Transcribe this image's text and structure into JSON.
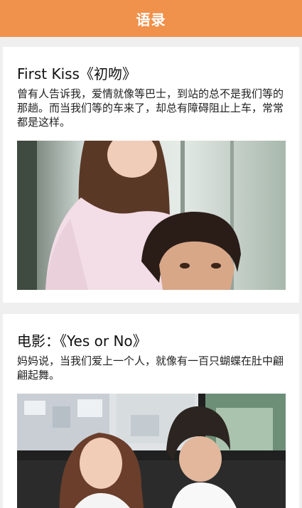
{
  "header": {
    "title": "语录"
  },
  "posts": [
    {
      "title": "First Kiss《初吻》",
      "text": "曾有人告诉我，爱情就像等巴士，到站的总不是我们等的那趟。而当我们等的车来了，却总有障碍阻止上车，常常都是这样。",
      "image": "couple-photo"
    },
    {
      "title": "电影：《Yes or No》",
      "text": "妈妈说，当我们爱上一个人，就像有一百只蝴蝶在肚中翩翩起舞。",
      "image": "two-girls-photo"
    }
  ],
  "colors": {
    "accent": "#f0914c",
    "background": "#efefef"
  }
}
